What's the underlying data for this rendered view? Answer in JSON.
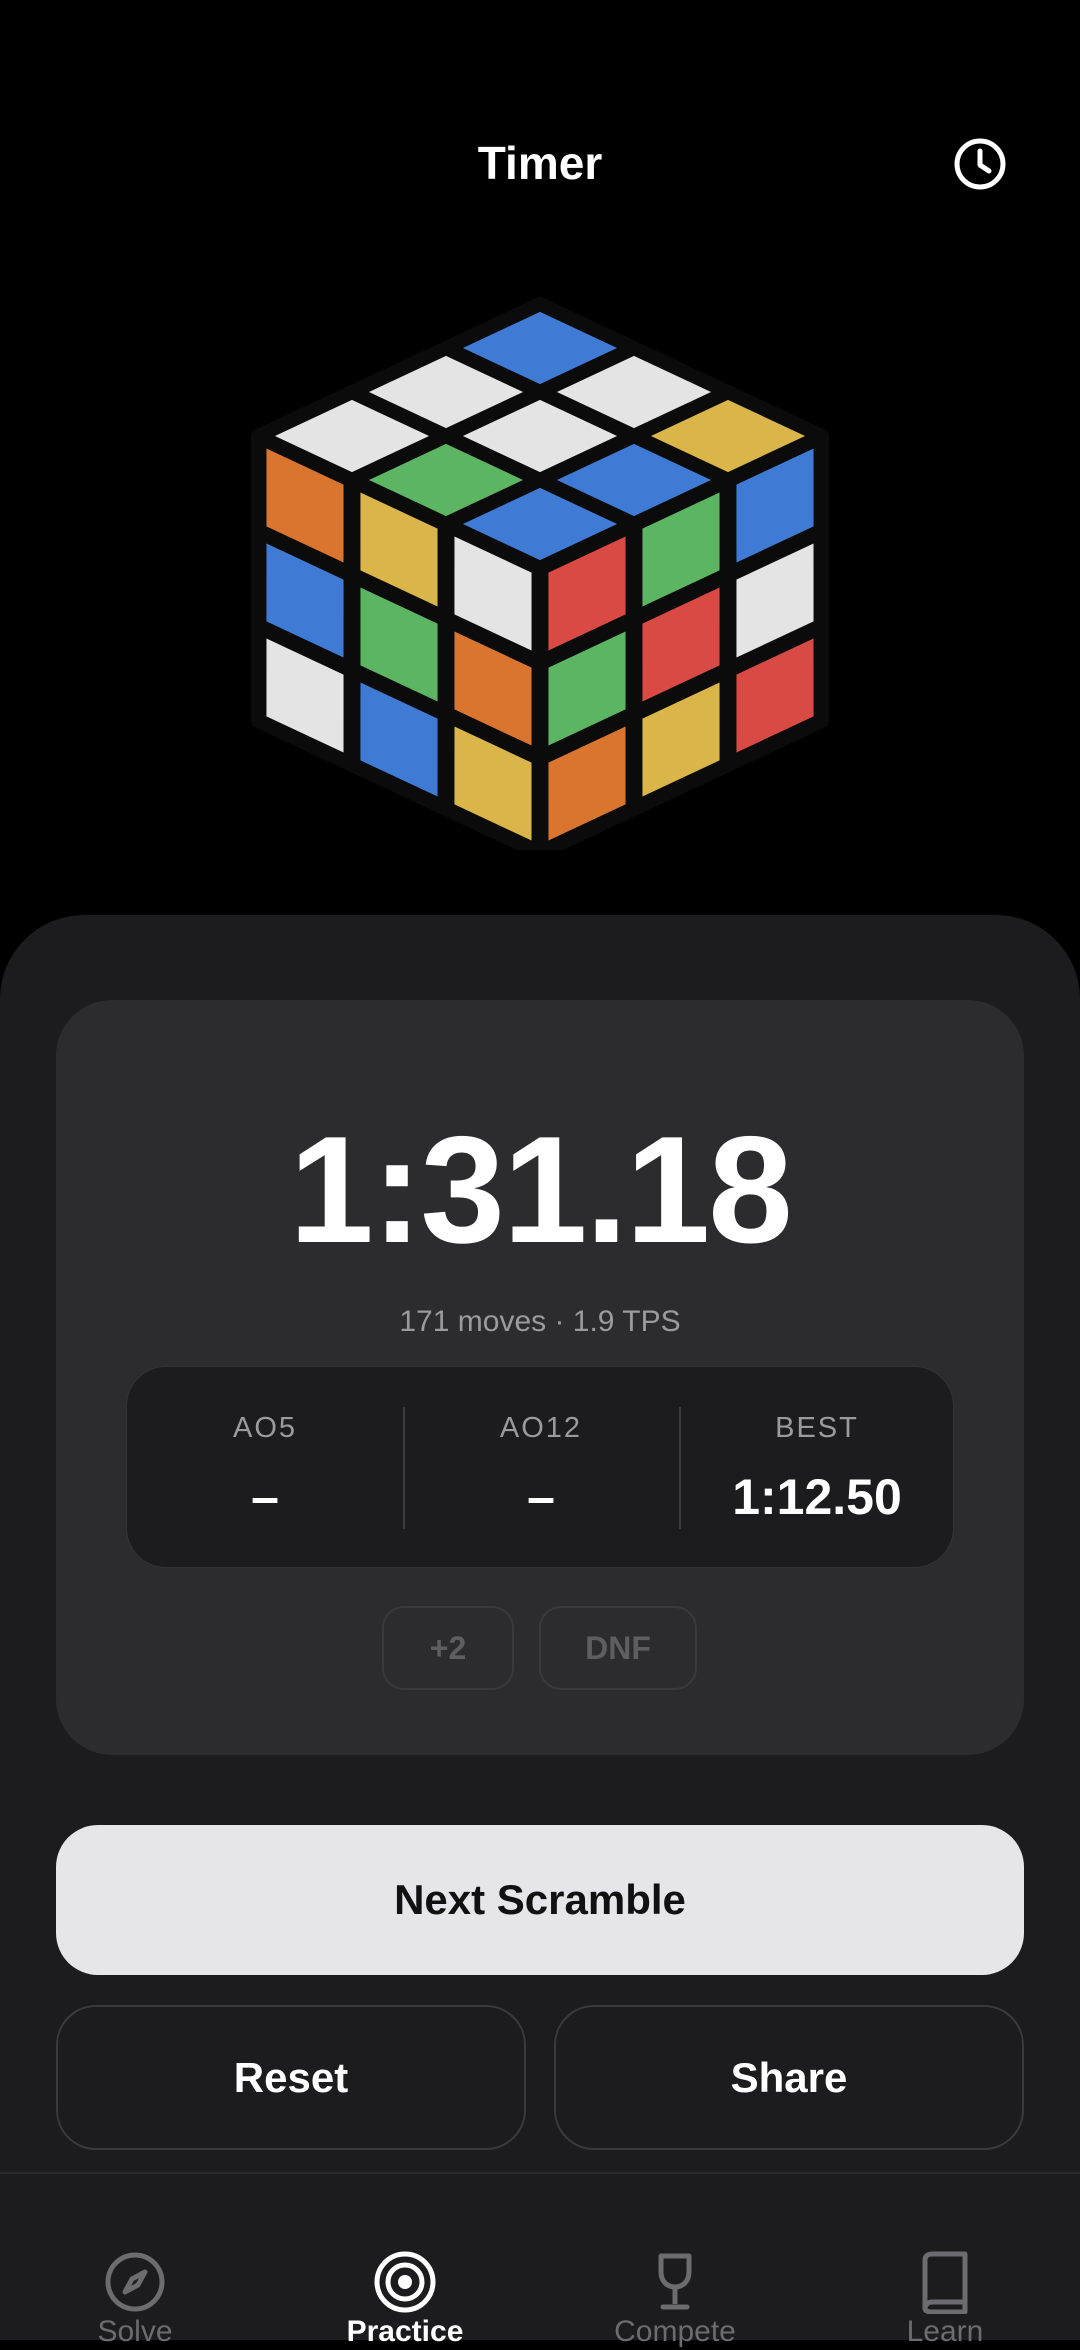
{
  "header": {
    "title": "Timer",
    "history_icon": "clock-icon"
  },
  "cube": {
    "top_face": [
      [
        "white",
        "white",
        "blue"
      ],
      [
        "green",
        "white",
        "white"
      ],
      [
        "blue",
        "blue",
        "yellow"
      ]
    ],
    "left_face": [
      [
        "orange",
        "yellow",
        "white"
      ],
      [
        "blue",
        "green",
        "orange"
      ],
      [
        "white",
        "blue",
        "yellow"
      ]
    ],
    "right_face": [
      [
        "red",
        "green",
        "blue"
      ],
      [
        "green",
        "red",
        "white"
      ],
      [
        "orange",
        "yellow",
        "red"
      ]
    ],
    "colors": {
      "white": "#e4e4e4",
      "yellow": "#d9b54a",
      "blue": "#3f7bd4",
      "green": "#5cb563",
      "red": "#d94a45",
      "orange": "#d9752f"
    }
  },
  "timer": {
    "time": "1:31.18",
    "moves_info": "171 moves · 1.9 TPS"
  },
  "stats": [
    {
      "label": "AO5",
      "value": "–"
    },
    {
      "label": "AO12",
      "value": "–"
    },
    {
      "label": "BEST",
      "value": "1:12.50"
    }
  ],
  "penalties": {
    "plus_two": "+2",
    "dnf": "DNF"
  },
  "actions": {
    "next_scramble": "Next Scramble",
    "reset": "Reset",
    "share": "Share"
  },
  "tabs": [
    {
      "label": "Solve",
      "icon": "compass-icon",
      "active": false
    },
    {
      "label": "Practice",
      "icon": "target-icon",
      "active": true
    },
    {
      "label": "Compete",
      "icon": "trophy-icon",
      "active": false
    },
    {
      "label": "Learn",
      "icon": "book-icon",
      "active": false
    }
  ]
}
